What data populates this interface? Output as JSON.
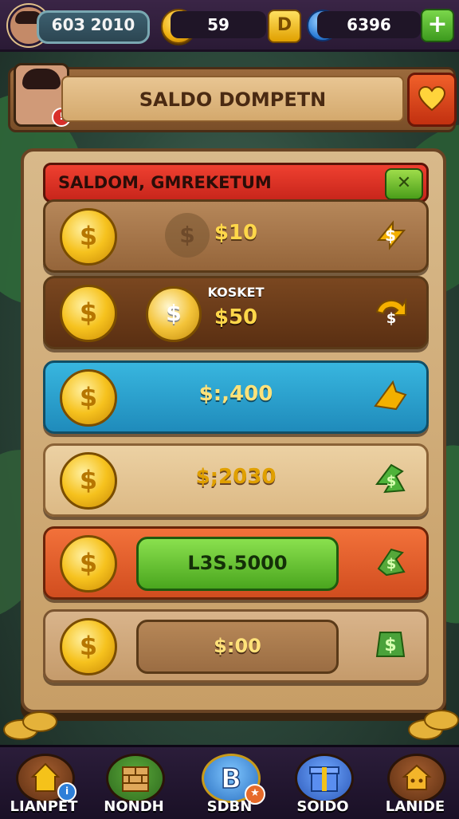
{
  "top_bar": {
    "level_value": "60З 2010",
    "coins_value": "59",
    "gold_letter": "D",
    "gems_value": "6396",
    "plus_label": "+",
    "coin_icon": "gold-coin-icon",
    "gem_icon": "blue-gem-icon"
  },
  "header": {
    "title": "SALDO DOMPETN",
    "avatar_badge": "!",
    "heart_icon": "heart-icon"
  },
  "panel": {
    "title": "SALDOM, GMREKETUM",
    "close_label": "✕"
  },
  "rows": [
    {
      "price_label": "$10",
      "arrow_color": "#f3b000"
    },
    {
      "subtitle": "KOSKET",
      "price_label": "$50",
      "arrow_color": "#f5b000"
    },
    {
      "price_label": "$:,400",
      "arrow_color": "#f2b000"
    },
    {
      "price_label": "$;2030",
      "arrow_color": "#4fb33a"
    },
    {
      "button_label": "L3S.5000",
      "arrow_color": "#55a83a"
    },
    {
      "button_label": "$:00",
      "arrow_color": "#4aa23a"
    }
  ],
  "bottom_nav": {
    "items": [
      {
        "label": "LIANPET",
        "icon": "house-icon",
        "badge": "i"
      },
      {
        "label": "NONDH",
        "icon": "bricks-icon",
        "badge": ""
      },
      {
        "label": "SDBN",
        "icon": "b-badge-icon",
        "badge": "★"
      },
      {
        "label": "SOIDO",
        "icon": "gift-box-icon",
        "badge": ""
      },
      {
        "label": "LANIDE",
        "icon": "home-icon",
        "badge": ""
      }
    ]
  },
  "colors": {
    "accent_red": "#ef4030",
    "accent_green": "#4aa61e",
    "accent_blue": "#1f8bbb",
    "wood": "#c79e66"
  }
}
